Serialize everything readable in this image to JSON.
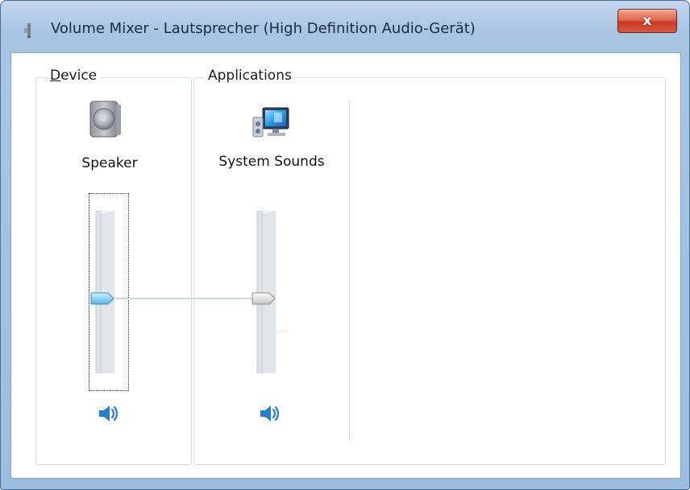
{
  "window": {
    "title": "Volume Mixer - Lautsprecher (High Definition Audio-Gerät)",
    "close_glyph": "x",
    "close_icon": "close-icon",
    "title_icon": "speaker-small-icon"
  },
  "groups": {
    "device_label": "Device",
    "device_accel_char": "D",
    "device_label_rest": "evice",
    "apps_label": "Applications"
  },
  "device": {
    "name": "Speaker",
    "icon": "speaker-icon",
    "volume_percent": 50,
    "mute_icon": "speaker-volume-icon"
  },
  "applications": [
    {
      "name": "System Sounds",
      "icon": "system-sounds-icon",
      "volume_percent": 50,
      "mute_icon": "speaker-volume-icon"
    }
  ],
  "colors": {
    "accent_thumb": "#8fd2ef",
    "inactive_thumb": "#d9d9d9",
    "mute_icon_blue": "#2b7fc9"
  }
}
